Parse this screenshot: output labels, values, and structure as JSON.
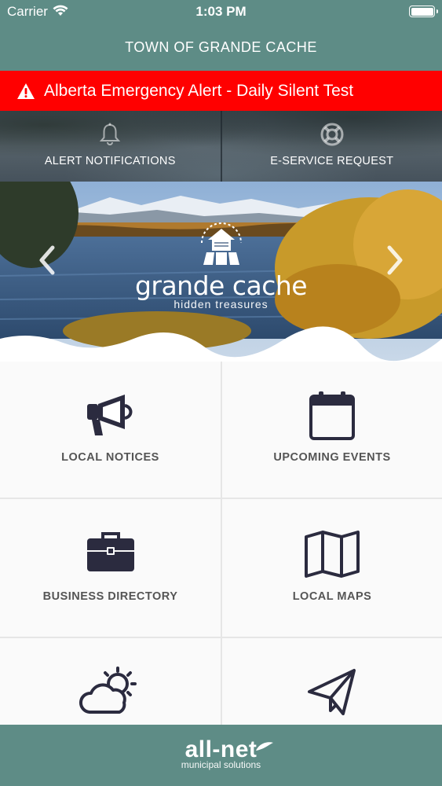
{
  "status_bar": {
    "carrier": "Carrier",
    "time": "1:03 PM"
  },
  "header": {
    "title": "TOWN OF GRANDE CACHE"
  },
  "alert": {
    "text": "Alberta Emergency Alert - Daily Silent Test",
    "color": "#ff0000"
  },
  "quick_actions": [
    {
      "label": "ALERT NOTIFICATIONS",
      "icon": "bell-icon"
    },
    {
      "label": "E-SERVICE REQUEST",
      "icon": "lifebuoy-icon"
    }
  ],
  "hero": {
    "logo_text": "grande cache",
    "tagline": "hidden treasures"
  },
  "tiles": [
    {
      "label": "LOCAL NOTICES",
      "icon": "megaphone-icon"
    },
    {
      "label": "UPCOMING EVENTS",
      "icon": "calendar-icon"
    },
    {
      "label": "BUSINESS DIRECTORY",
      "icon": "briefcase-icon"
    },
    {
      "label": "LOCAL MAPS",
      "icon": "map-icon"
    },
    {
      "label": "",
      "icon": "weather-icon"
    },
    {
      "label": "",
      "icon": "paper-plane-icon"
    }
  ],
  "footer": {
    "brand": "all-net",
    "subtitle": "municipal solutions"
  },
  "colors": {
    "primary": "#5e8c86",
    "alert": "#ff0000",
    "icon": "#2b2b3f",
    "label": "#555555"
  }
}
